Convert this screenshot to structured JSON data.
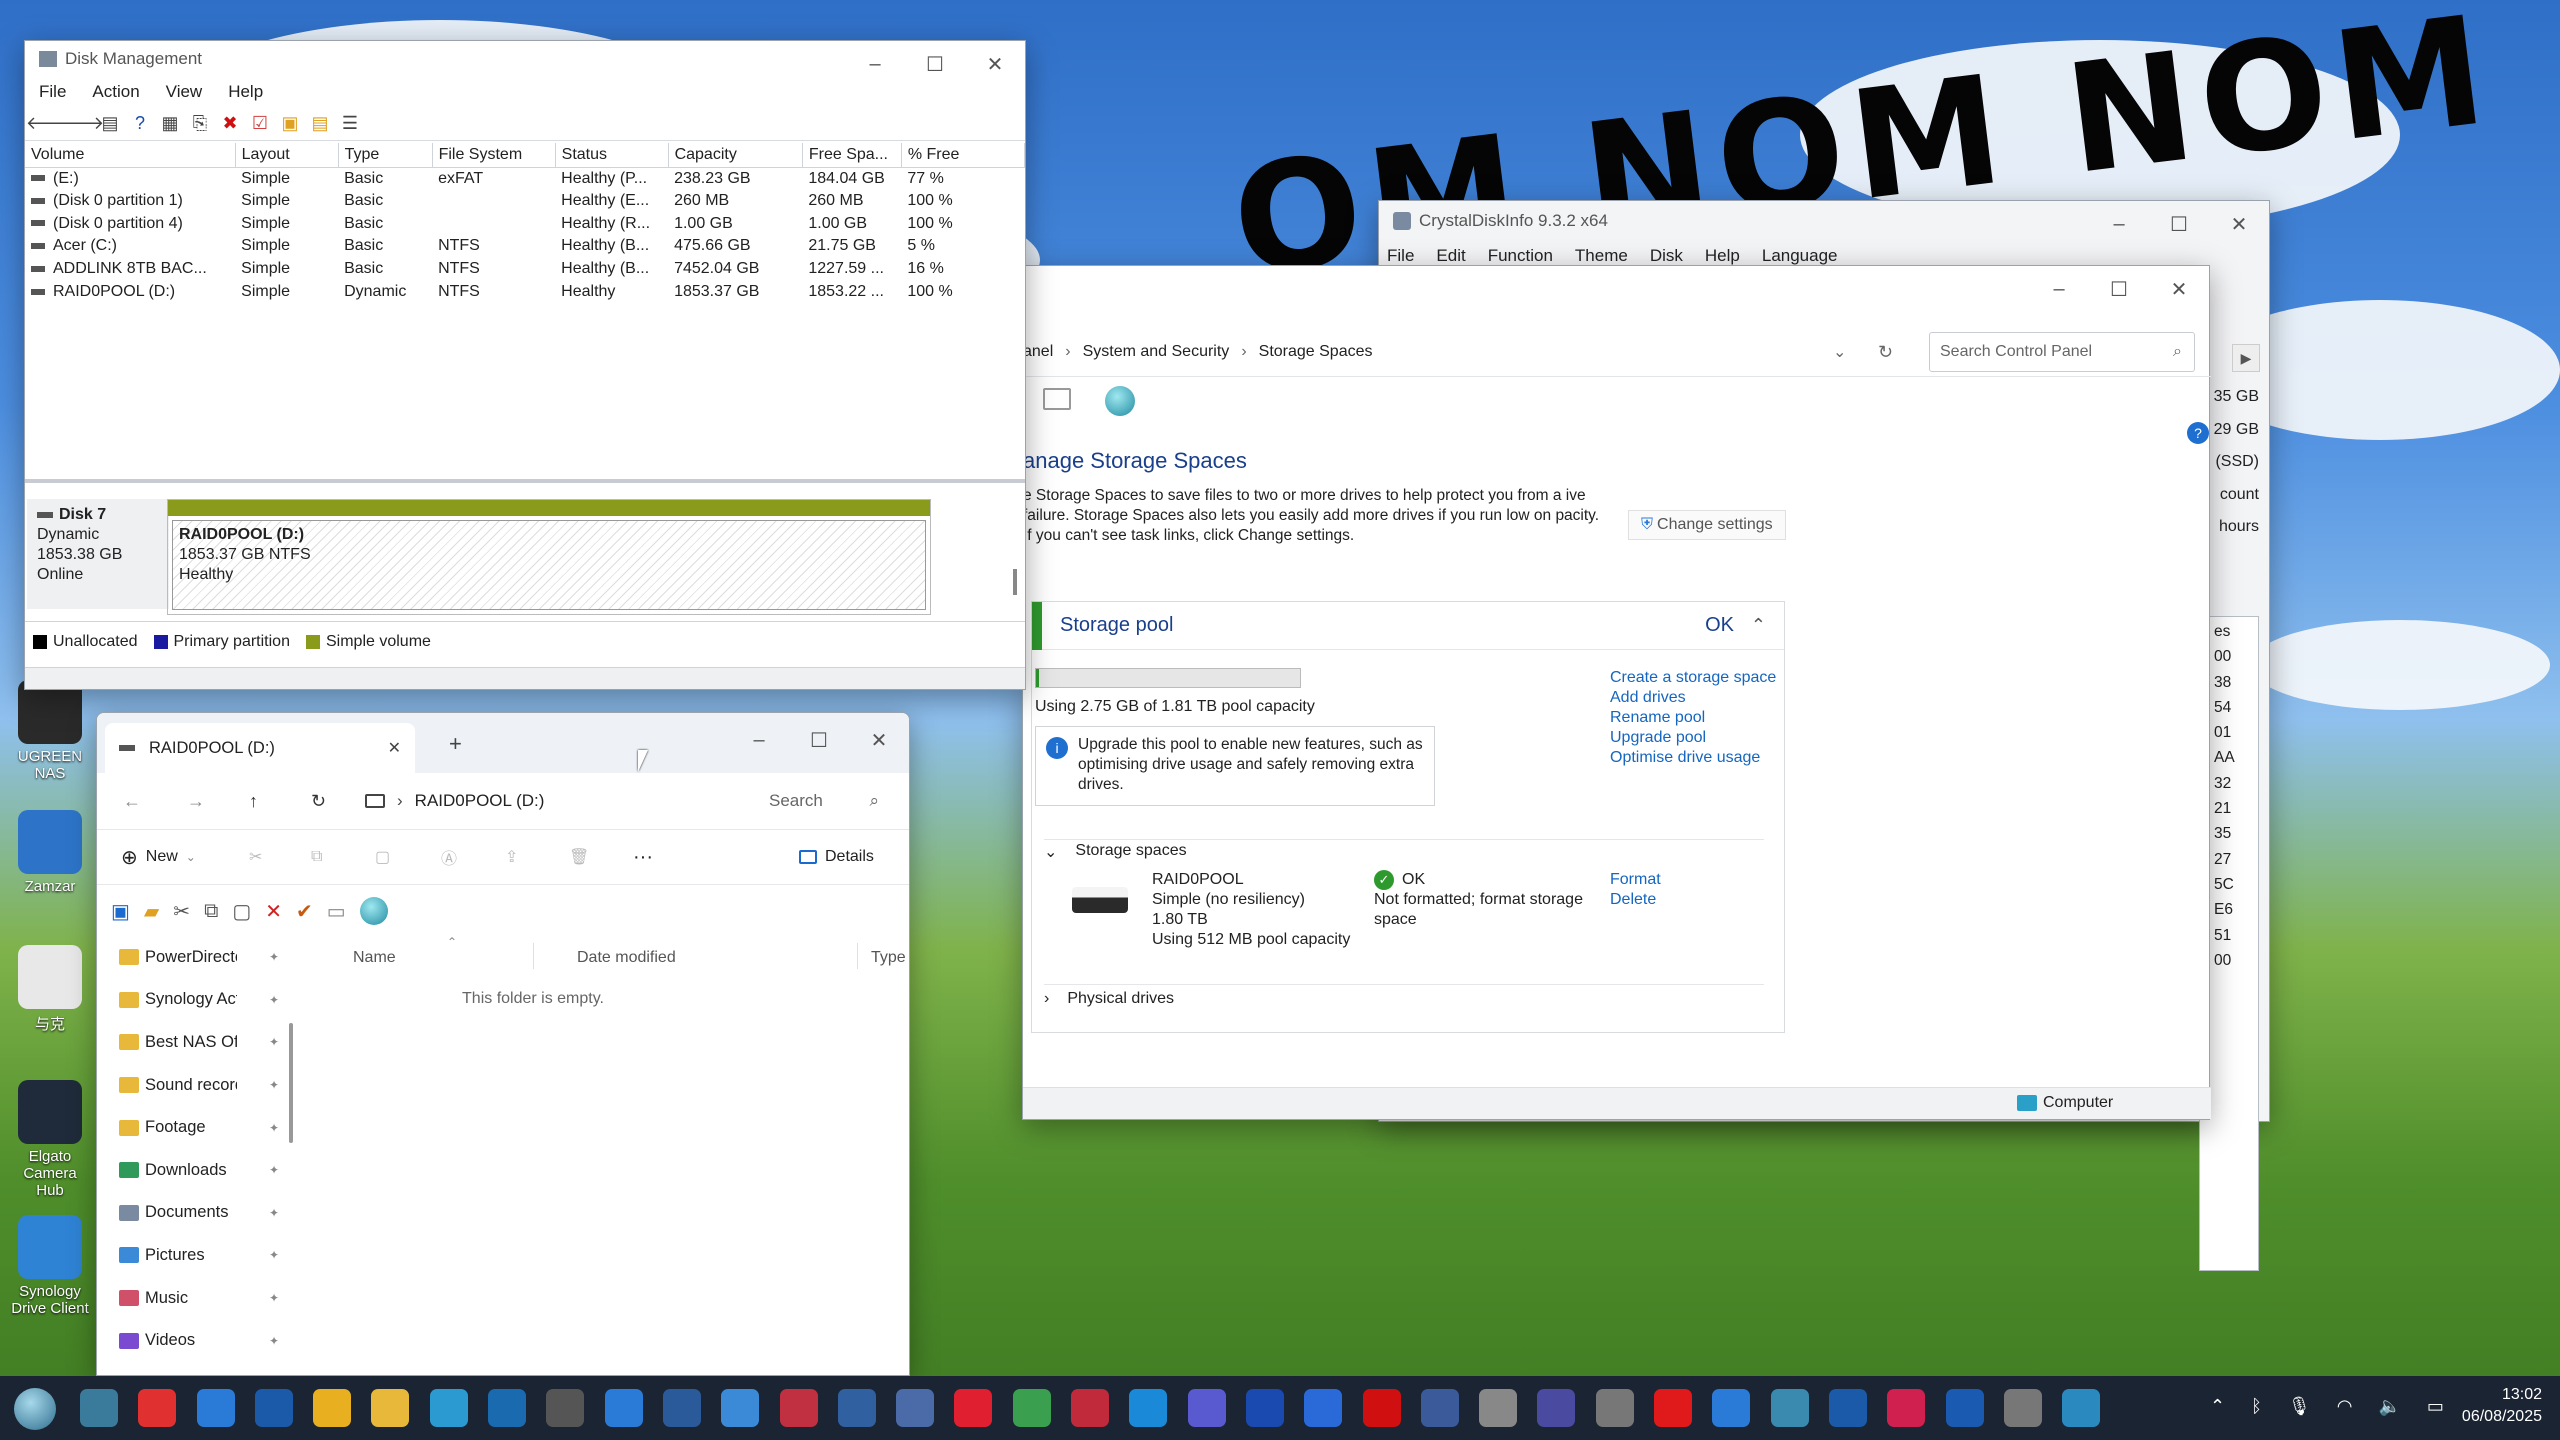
{
  "desktop": {
    "scribble_text": "OM NOM NOM",
    "icons": [
      {
        "label": "UGREEN NAS",
        "color": "#2a2a2a"
      },
      {
        "label": "Zamzar",
        "color": "#2d74c8"
      },
      {
        "label": "与克",
        "color": "#e8e8e8"
      },
      {
        "label": "Elgato Camera Hub",
        "color": "#1f2b3a"
      },
      {
        "label": "Synology Drive Client",
        "color": "#2f83d4"
      }
    ]
  },
  "disk_mgmt": {
    "title": "Disk Management",
    "menu": [
      "File",
      "Action",
      "View",
      "Help"
    ],
    "columns": [
      "Volume",
      "Layout",
      "Type",
      "File System",
      "Status",
      "Capacity",
      "Free Spa...",
      "% Free"
    ],
    "rows": [
      [
        "(E:)",
        "Simple",
        "Basic",
        "exFAT",
        "Healthy (P...",
        "238.23 GB",
        "184.04 GB",
        "77 %"
      ],
      [
        "(Disk 0 partition 1)",
        "Simple",
        "Basic",
        "",
        "Healthy (E...",
        "260 MB",
        "260 MB",
        "100 %"
      ],
      [
        "(Disk 0 partition 4)",
        "Simple",
        "Basic",
        "",
        "Healthy (R...",
        "1.00 GB",
        "1.00 GB",
        "100 %"
      ],
      [
        "Acer (C:)",
        "Simple",
        "Basic",
        "NTFS",
        "Healthy (B...",
        "475.66 GB",
        "21.75 GB",
        "5 %"
      ],
      [
        "ADDLINK 8TB BAC...",
        "Simple",
        "Basic",
        "NTFS",
        "Healthy (B...",
        "7452.04 GB",
        "1227.59 ...",
        "16 %"
      ],
      [
        "RAID0POOL (D:)",
        "Simple",
        "Dynamic",
        "NTFS",
        "Healthy",
        "1853.37 GB",
        "1853.22 ...",
        "100 %"
      ]
    ],
    "disk": {
      "name": "Disk 7",
      "type": "Dynamic",
      "size": "1853.38 GB",
      "state": "Online"
    },
    "partition": {
      "name": "RAID0POOL (D:)",
      "size_fs": "1853.37 GB NTFS",
      "status": "Healthy"
    },
    "legend": [
      "Unallocated",
      "Primary partition",
      "Simple volume"
    ],
    "legend_colors": [
      "#000000",
      "#1a1aa0",
      "#8a9a1a"
    ]
  },
  "crystal": {
    "title": "CrystalDiskInfo 9.3.2 x64",
    "menu": [
      "File",
      "Edit",
      "Function",
      "Theme",
      "Disk",
      "Help",
      "Language"
    ],
    "side_values": [
      "35 GB",
      "29 GB",
      "(SSD)",
      "count",
      "hours"
    ],
    "list_values": [
      "es",
      "00",
      "38",
      "54",
      "01",
      "AA",
      "32",
      "21",
      "35",
      "27",
      "5C",
      "E6",
      "51",
      "00"
    ]
  },
  "control_panel": {
    "breadcrumb": [
      "anel",
      "System and Security",
      "Storage Spaces"
    ],
    "search_placeholder": "Search Control Panel",
    "heading": "anage Storage Spaces",
    "description": "e Storage Spaces to save files to two or more drives to help protect you from a ive failure. Storage Spaces also lets you easily add more drives if you run low on pacity. If you can't see task links, click Change settings.",
    "change_settings": "Change settings",
    "pool": {
      "title": "Storage pool",
      "status": "OK",
      "usage": "Using 2.75 GB of 1.81 TB pool capacity",
      "usage_fraction": 0.0015,
      "info": "Upgrade this pool to enable new features, such as optimising drive usage and safely removing extra drives.",
      "links": [
        "Create a storage space",
        "Add drives",
        "Rename pool",
        "Upgrade pool",
        "Optimise drive usage"
      ]
    },
    "spaces_heading": "Storage spaces",
    "space": {
      "name": "RAID0POOL",
      "resiliency": "Simple (no resiliency)",
      "size": "1.80 TB",
      "usage": "Using 512 MB pool capacity",
      "status": "OK",
      "note": "Not formatted; format storage space",
      "links": [
        "Format",
        "Delete"
      ]
    },
    "physical_heading": "Physical drives",
    "footer": "Computer"
  },
  "explorer": {
    "tab_title": "RAID0POOL (D:)",
    "address": "RAID0POOL (D:)",
    "search": "Search",
    "new_label": "New",
    "details_label": "Details",
    "columns": [
      "Name",
      "Date modified",
      "Type"
    ],
    "empty": "This folder is empty.",
    "sidebar": [
      {
        "label": "PowerDirecto",
        "color": "#e8b83a"
      },
      {
        "label": "Synology Act",
        "color": "#e8b83a"
      },
      {
        "label": "Best NAS Of",
        "color": "#e8b83a"
      },
      {
        "label": "Sound record",
        "color": "#e8b83a"
      },
      {
        "label": "Footage",
        "color": "#e8b83a"
      },
      {
        "label": "Downloads",
        "color": "#2f9a5a"
      },
      {
        "label": "Documents",
        "color": "#7a8aa0"
      },
      {
        "label": "Pictures",
        "color": "#3a8ad8"
      },
      {
        "label": "Music",
        "color": "#d0506a"
      },
      {
        "label": "Videos",
        "color": "#7a4ad0"
      }
    ]
  },
  "taskbar": {
    "time": "13:02",
    "date": "06/08/2025",
    "icon_colors": [
      "#3a7a9a",
      "#e03030",
      "#2a7ad8",
      "#1a5aa8",
      "#e8b020",
      "#e8b83a",
      "#2a9ad0",
      "#1a6ab0",
      "#555555",
      "#2a7ad8",
      "#2a5a9a",
      "#3a8ad8",
      "#c03040",
      "#3060a0",
      "#4a6aa8",
      "#e02030",
      "#3aa050",
      "#c02a3a",
      "#1a8ad8",
      "#5a5ad0",
      "#1a4ab0",
      "#2a6ad8",
      "#d01010",
      "#3a5a9a",
      "#888888",
      "#4a4aa0",
      "#777777",
      "#e01a1a",
      "#2a7ad8",
      "#3a8ab0",
      "#1a5aa8",
      "#d02050",
      "#1a5ab0",
      "#777777",
      "#2a8ac0"
    ]
  }
}
